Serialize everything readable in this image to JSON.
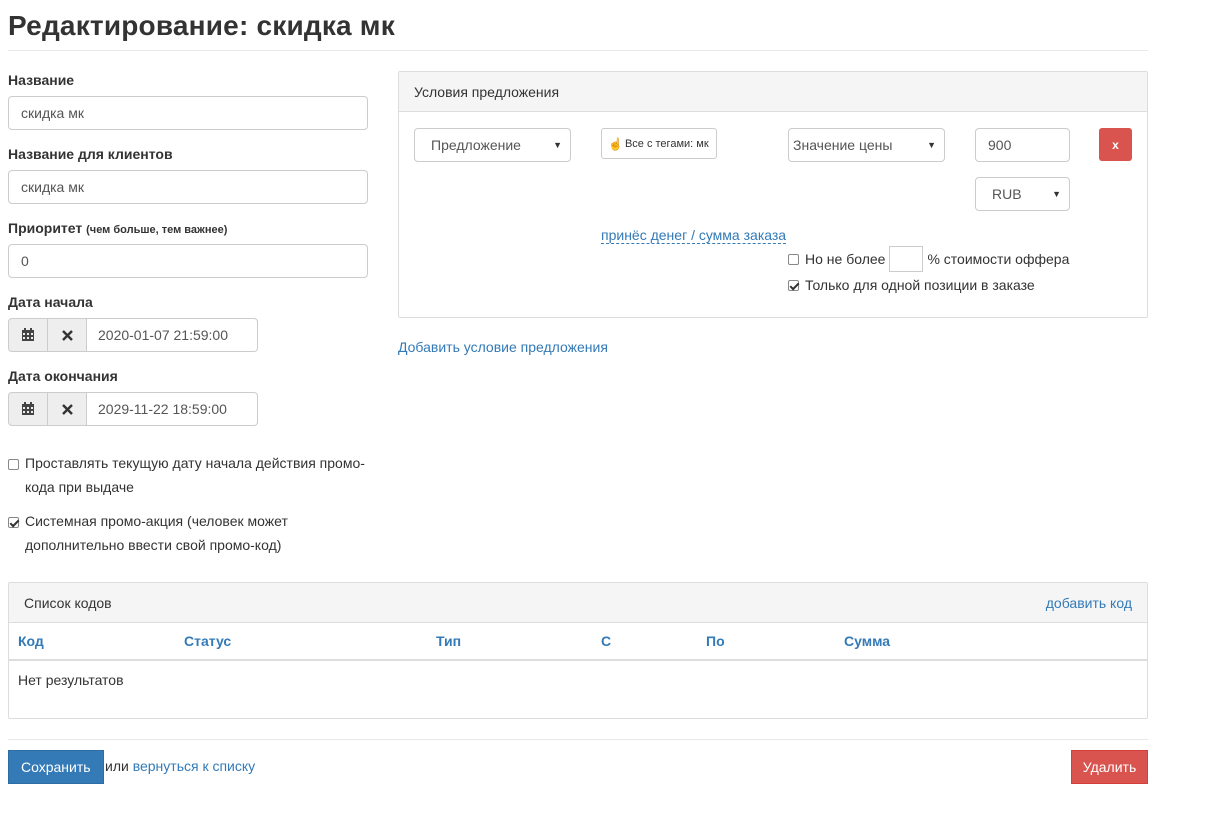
{
  "page": {
    "title": "Редактирование: скидка мк"
  },
  "form": {
    "name_label": "Название",
    "name_value": "скидка мк",
    "client_name_label": "Название для клиентов",
    "client_name_value": "скидка мк",
    "priority_label": "Приоритет",
    "priority_hint": "(чем больше, тем важнее)",
    "priority_value": "0",
    "start_date_label": "Дата начала",
    "start_date_value": "2020-01-07 21:59:00",
    "end_date_label": "Дата окончания",
    "end_date_value": "2029-11-22 18:59:00",
    "set_current_date_line1": "Проставлять текущую дату начала действия промо-",
    "set_current_date_line2": "кода при выдаче",
    "set_current_date_checked": false,
    "system_promo_line1": "Системная промо-акция (человек может",
    "system_promo_line2": "дополнительно ввести свой промо-код)",
    "system_promo_checked": true
  },
  "conditions": {
    "panel_title": "Условия предложения",
    "type_select": "Предложение",
    "tag_button": "Все с тегами: мк",
    "value_select": "Значение цены",
    "amount": "900",
    "currency": "RUB",
    "remove_button": "x",
    "formula_link": "принёс денег / сумма заказа",
    "max_percent_prefix": "Но не более",
    "max_percent_value": "",
    "max_percent_suffix": "% стоимости оффера",
    "max_percent_checked": false,
    "single_position_label": "Только для одной позиции в заказе",
    "single_position_checked": true,
    "add_condition_link": "Добавить условие предложения"
  },
  "codes": {
    "panel_title": "Список кодов",
    "add_code_link": "добавить код",
    "columns": [
      "Код",
      "Статус",
      "Тип",
      "С",
      "По",
      "Сумма"
    ],
    "empty_text": "Нет результатов"
  },
  "footer": {
    "save_button": "Сохранить",
    "or_text": "или",
    "back_link": "вернуться к списку",
    "delete_button": "Удалить"
  },
  "colors": {
    "primary": "#337ab7",
    "danger": "#d9534f",
    "link": "#337ab7"
  }
}
